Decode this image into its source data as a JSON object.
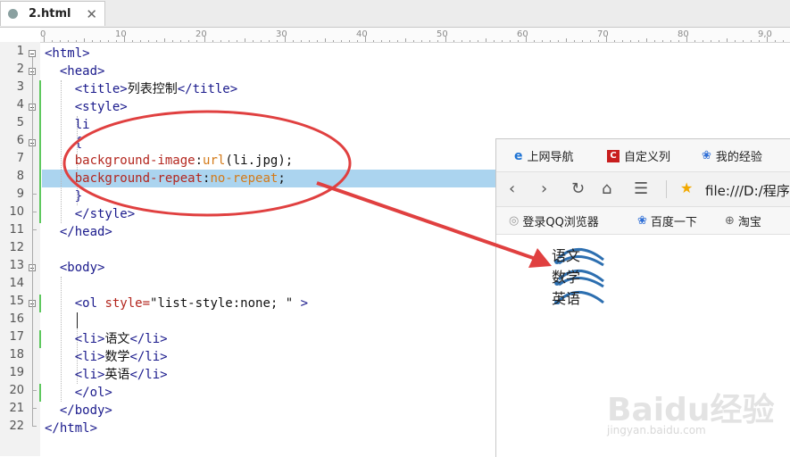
{
  "tab": {
    "name": "2.html",
    "close": "✕"
  },
  "ruler": [
    "0",
    "10",
    "20",
    "30",
    "40",
    "50",
    "60",
    "70",
    "80",
    "9,0"
  ],
  "line_numbers": [
    "1",
    "2",
    "3",
    "4",
    "5",
    "6",
    "7",
    "8",
    "9",
    "10",
    "11",
    "12",
    "13",
    "14",
    "15",
    "16",
    "17",
    "18",
    "19",
    "20",
    "21",
    "22"
  ],
  "code": {
    "l1": "<html>",
    "l2": "<head>",
    "l3_open": "<title>",
    "l3_text": "列表控制",
    "l3_close": "</title>",
    "l4": "<style>",
    "l5": "li",
    "l6": "{",
    "l7_prop": "background-image",
    "l7_colon": ":",
    "l7_val": "url",
    "l7_rest": "(li.jpg);",
    "l8_prop": "background-repeat",
    "l8_colon": ":",
    "l8_val": "no-repeat",
    "l8_semi": ";",
    "l9": "}",
    "l10": "</style>",
    "l11": "</head>",
    "l13": "<body>",
    "l15_open": "<ol ",
    "l15_attr": "style=",
    "l15_str": "\"list-style:none; \"",
    "l15_close": " >",
    "l17_open": "<li>",
    "l17_text": "语文",
    "l17_close": "</li>",
    "l18_open": "<li>",
    "l18_text": "数学",
    "l18_close": "</li>",
    "l19_open": "<li>",
    "l19_text": "英语",
    "l19_close": "</li>",
    "l20": "</ol>",
    "l21": "</body>",
    "l22": "</html>"
  },
  "browser": {
    "bookmarks": [
      "上网导航",
      "自定义列",
      "我的经验"
    ],
    "address": "file:///D:/程序",
    "favorites": [
      "登录QQ浏览器",
      "百度一下",
      "淘宝"
    ],
    "list_items": [
      "语文",
      "数学",
      "英语"
    ]
  },
  "watermark": {
    "main": "Baidu经验",
    "sub": "jingyan.baidu.com"
  }
}
